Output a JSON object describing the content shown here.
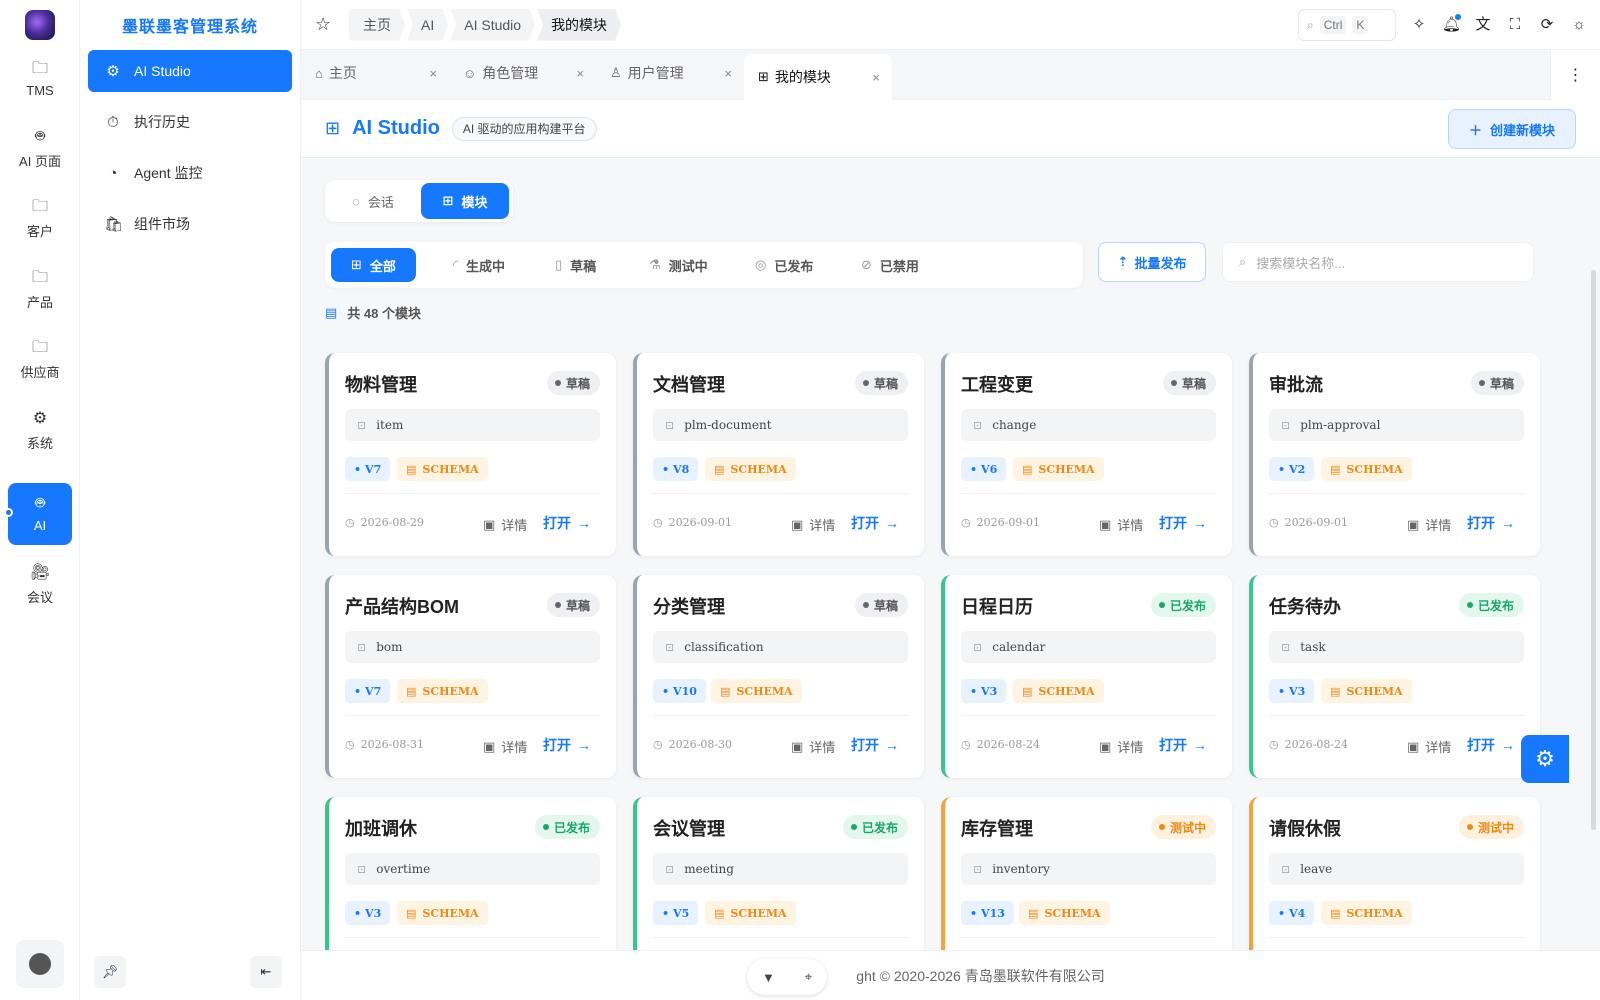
{
  "rail": {
    "items": [
      {
        "label": "TMS",
        "icon": "folder-icon"
      },
      {
        "label": "AI 页面",
        "icon": "robot-icon"
      },
      {
        "label": "客户",
        "icon": "folder-icon"
      },
      {
        "label": "产品",
        "icon": "folder-icon"
      },
      {
        "label": "供应商",
        "icon": "folder-icon"
      },
      {
        "label": "系统",
        "icon": "gear-icon"
      },
      {
        "label": "AI",
        "icon": "robot-icon"
      },
      {
        "label": "会议",
        "icon": "video-icon"
      }
    ],
    "active": "AI"
  },
  "sidebar": {
    "title": "墨联墨客管理系统",
    "items": [
      {
        "label": "AI Studio",
        "icon": "gear-icon"
      },
      {
        "label": "执行历史",
        "icon": "timer-icon"
      },
      {
        "label": "Agent 监控",
        "icon": "gauge-icon"
      },
      {
        "label": "组件市场",
        "icon": "store-icon"
      }
    ]
  },
  "topbar": {
    "breadcrumbs": [
      "主页",
      "AI",
      "AI Studio",
      "我的模块"
    ],
    "search_key1": "Ctrl",
    "search_key2": "K"
  },
  "tabs": [
    {
      "label": "主页",
      "icon": "home-icon"
    },
    {
      "label": "角色管理",
      "icon": "role-icon"
    },
    {
      "label": "用户管理",
      "icon": "user-icon"
    },
    {
      "label": "我的模块",
      "icon": "grid-icon"
    }
  ],
  "page": {
    "title": "AI Studio",
    "subtitle": "AI 驱动的应用构建平台",
    "create_label": "创建新模块",
    "modes": [
      "会话",
      "模块"
    ],
    "filters": [
      "全部",
      "生成中",
      "草稿",
      "测试中",
      "已发布",
      "已禁用"
    ],
    "batch_label": "批量发布",
    "search_placeholder": "搜索模块名称...",
    "count_text": "共 48 个模块",
    "detail_label": "详情",
    "open_label": "打开",
    "schema_label": "SCHEMA"
  },
  "cards": [
    {
      "title": "物料管理",
      "status": "草稿",
      "code": "item",
      "version": "V7",
      "date": "2026-08-29"
    },
    {
      "title": "文档管理",
      "status": "草稿",
      "code": "plm-document",
      "version": "V8",
      "date": "2026-09-01"
    },
    {
      "title": "工程变更",
      "status": "草稿",
      "code": "change",
      "version": "V6",
      "date": "2026-09-01"
    },
    {
      "title": "审批流",
      "status": "草稿",
      "code": "plm-approval",
      "version": "V2",
      "date": "2026-09-01"
    },
    {
      "title": "产品结构BOM",
      "status": "草稿",
      "code": "bom",
      "version": "V7",
      "date": "2026-08-31"
    },
    {
      "title": "分类管理",
      "status": "草稿",
      "code": "classification",
      "version": "V10",
      "date": "2026-08-30"
    },
    {
      "title": "日程日历",
      "status": "已发布",
      "code": "calendar",
      "version": "V3",
      "date": "2026-08-24"
    },
    {
      "title": "任务待办",
      "status": "已发布",
      "code": "task",
      "version": "V3",
      "date": "2026-08-24"
    },
    {
      "title": "加班调休",
      "status": "已发布",
      "code": "overtime",
      "version": "V3",
      "date": ""
    },
    {
      "title": "会议管理",
      "status": "已发布",
      "code": "meeting",
      "version": "V5",
      "date": ""
    },
    {
      "title": "库存管理",
      "status": "测试中",
      "code": "inventory",
      "version": "V13",
      "date": ""
    },
    {
      "title": "请假休假",
      "status": "测试中",
      "code": "leave",
      "version": "V4",
      "date": ""
    }
  ],
  "footer": {
    "text": "ght © 2020-2026 青岛墨联软件有限公司"
  }
}
